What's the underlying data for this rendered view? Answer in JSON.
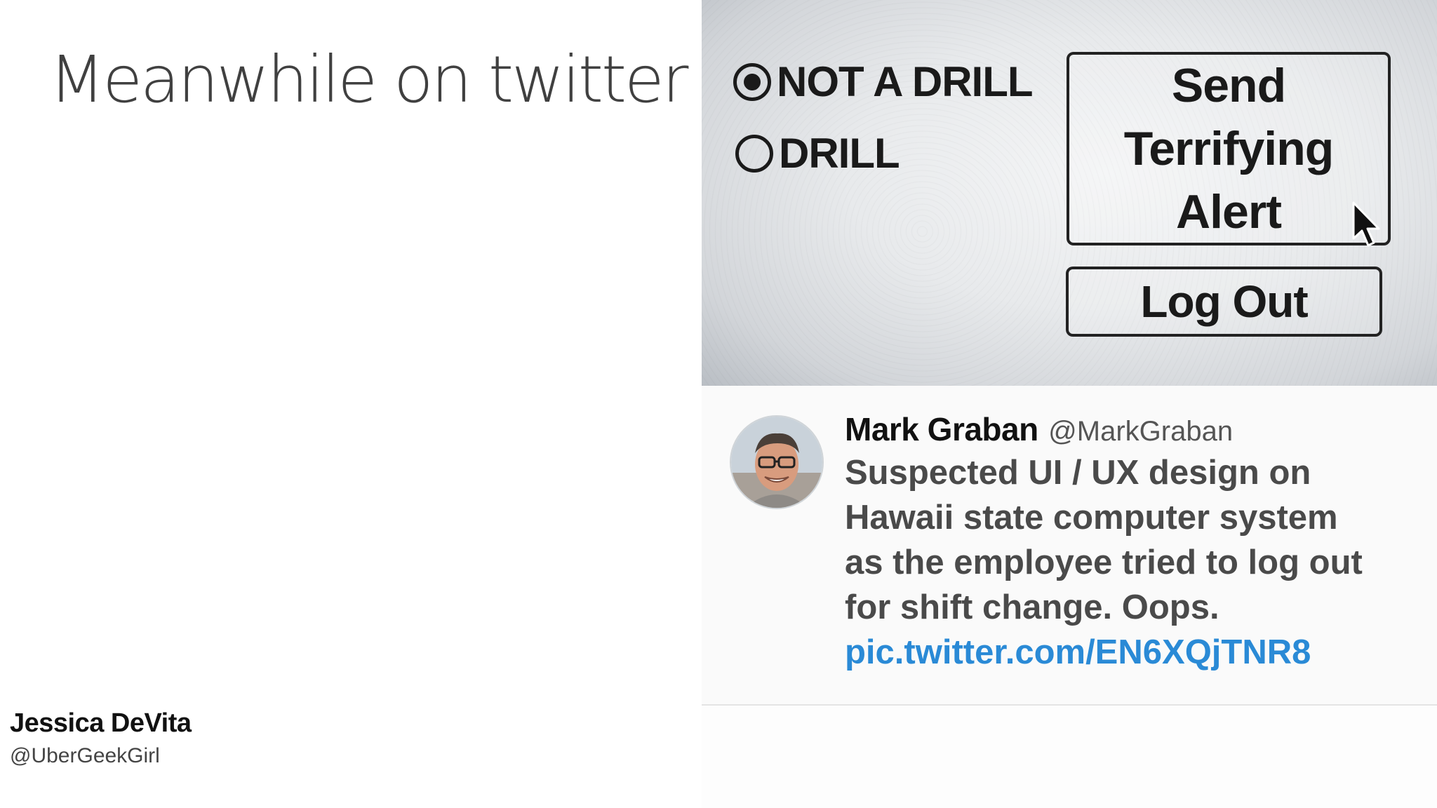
{
  "slide": {
    "title": "Meanwhile on twitter",
    "author_name": "Jessica DeVita",
    "author_handle": "@UberGeekGirl"
  },
  "screenshot": {
    "radio_options": [
      {
        "label": "NOT A DRILL",
        "selected": true
      },
      {
        "label": "DRILL",
        "selected": false
      }
    ],
    "alert_button_lines": [
      "Send",
      "Terrifying",
      "Alert"
    ],
    "logout_button": "Log Out",
    "icons": [
      "radio-selected-icon",
      "radio-empty-icon",
      "mouse-cursor-icon"
    ]
  },
  "tweet": {
    "name": "Mark Graban",
    "handle": "@MarkGraban",
    "text_lines": [
      "Suspected UI / UX design on",
      "Hawaii state computer system",
      "as the employee tried to log out",
      "for shift change. Oops."
    ],
    "link": "pic.twitter.com/EN6XQjTNR8",
    "colors": {
      "link": "#2a8ad6",
      "text": "#4a4a4a"
    }
  }
}
